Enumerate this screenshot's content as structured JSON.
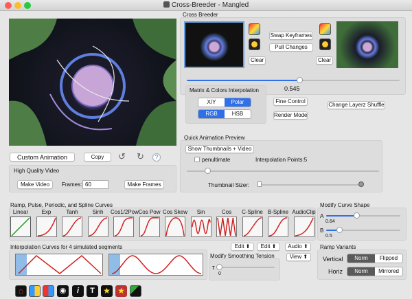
{
  "window": {
    "title": "Cross-Breeder - Mangled"
  },
  "cross_breeder": {
    "heading": "Cross Breeder",
    "swap_label": "Swap Keyframes",
    "pull_label": "Pull Changes",
    "clear_left": "Clear",
    "clear_right": "Clear",
    "slider_value": "0.545",
    "slider_fraction": 0.545
  },
  "matrix": {
    "heading": "Matrix & Colors Interpolation",
    "xy": "X/Y",
    "polar": "Polar",
    "rgb": "RGB",
    "hsb": "HSB",
    "fine_control": "Fine Control",
    "render_mode": "Render Mode",
    "change_shuffle": "Change Layerz Shuffle"
  },
  "left_controls": {
    "custom_animation": "Custom Animation",
    "copy": "Copy",
    "help": "?"
  },
  "hq_video": {
    "heading": "High Quality Video",
    "make_video": "Make Video",
    "frames_label": "Frames:",
    "frames_value": "60",
    "make_frames": "Make Frames"
  },
  "quick_preview": {
    "heading": "Quick Animation Preview",
    "show_thumbs": "Show Thumbnails + Video",
    "penultimate": "penultimate",
    "interp_points": "Interpolation Points:5",
    "interp_fraction": 0.15,
    "thumb_sizer": "Thumbnail Sizer:",
    "thumb_fraction": 0.02
  },
  "ramp": {
    "heading": "Ramp, Pulse, Periodic, and Spline Curves",
    "curves": [
      "Linear",
      "Exp",
      "Tanh",
      "Sinh",
      "Cos1/2Pow",
      "Cos Pow",
      "Cos Skew",
      "Sin",
      "Cos",
      "C-Spline",
      "B-Spline",
      "AudioClip"
    ]
  },
  "modify_curve": {
    "heading": "Modify Curve Shape",
    "a_label": "A",
    "a_value": "0.64",
    "a_fraction": 0.4,
    "b_label": "B",
    "b_value": "0.5",
    "b_fraction": 0.2
  },
  "interp_curves": {
    "heading": "Interpolation Curves for 4 simulated segments"
  },
  "edit_buttons": {
    "edit1": "Edit",
    "edit2": "Edit",
    "audio": "Audio",
    "view": "View"
  },
  "smoothing": {
    "heading": "Modify Smoothing Tension",
    "symbol": "τ",
    "value": "0",
    "fraction": 0.0
  },
  "ramp_variants": {
    "heading": "Ramp Variants",
    "vertical": "Vertical",
    "horiz": "Horiz",
    "norm1": "Norm",
    "flipped": "Flipped",
    "norm2": "Norm",
    "mirrored": "Mirrored"
  },
  "colors": {
    "accent": "#2f6fe8",
    "curve": "#d22020",
    "selection": "#8fbde8"
  }
}
